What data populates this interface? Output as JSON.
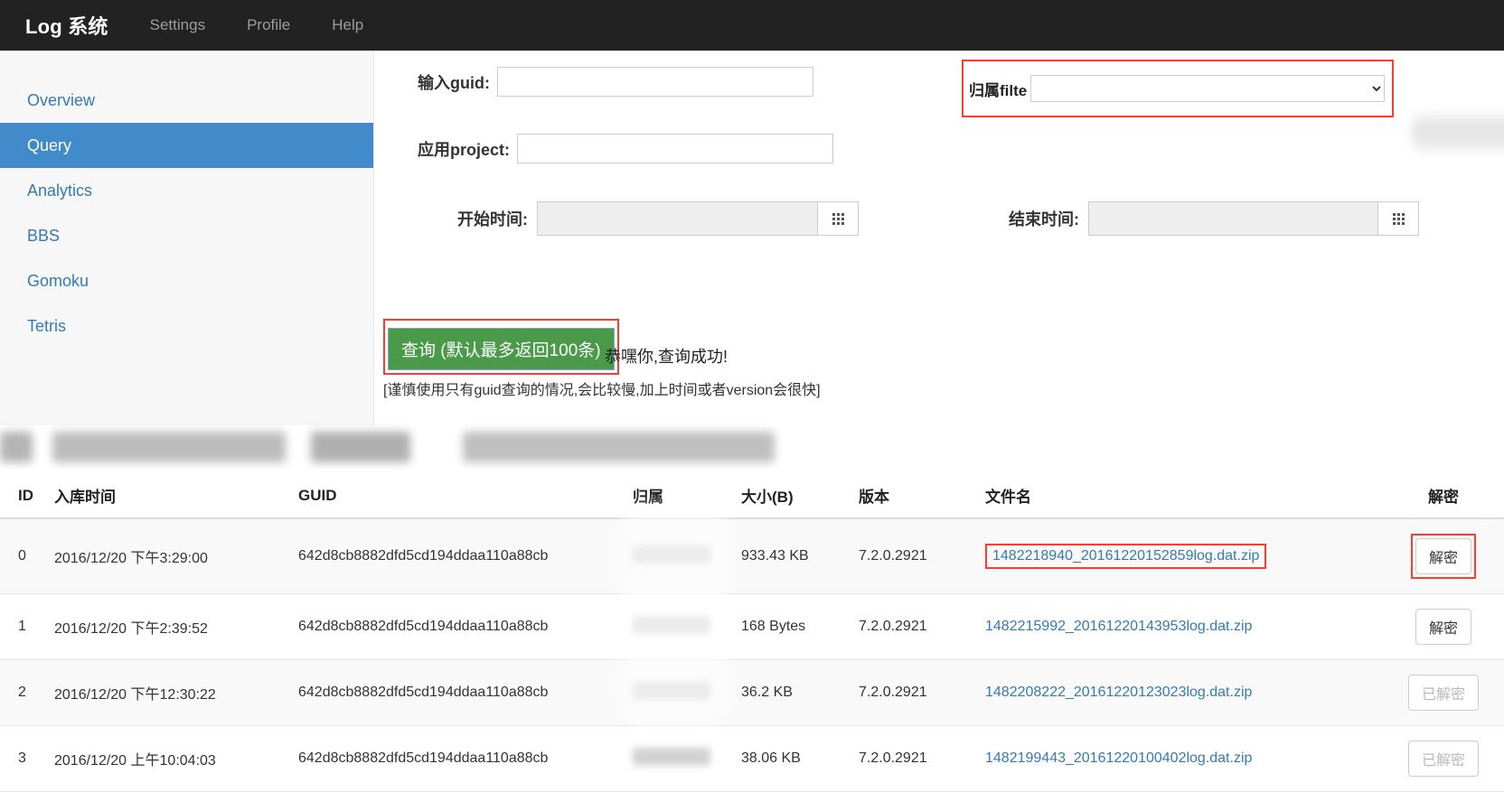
{
  "navbar": {
    "brand": "Log 系统",
    "links": [
      {
        "label": "Settings"
      },
      {
        "label": "Profile"
      },
      {
        "label": "Help"
      }
    ]
  },
  "sidebar": {
    "items": [
      {
        "label": "Overview",
        "active": false
      },
      {
        "label": "Query",
        "active": true
      },
      {
        "label": "Analytics",
        "active": false
      },
      {
        "label": "BBS",
        "active": false
      },
      {
        "label": "Gomoku",
        "active": false
      },
      {
        "label": "Tetris",
        "active": false
      }
    ]
  },
  "form": {
    "guid": {
      "label": "输入guid:",
      "value": "",
      "placeholder": ""
    },
    "project": {
      "label": "应用project:",
      "value": "",
      "placeholder": ""
    },
    "owner_filter": {
      "label": "归属filte",
      "value": "",
      "placeholder": ""
    },
    "start_time": {
      "label": "开始时间:",
      "value": "",
      "placeholder": ""
    },
    "end_time": {
      "label": "结束时间:",
      "value": "",
      "placeholder": ""
    },
    "calendar_icon": "calendar-icon"
  },
  "actions": {
    "query_button": "查询 (默认最多返回100条)",
    "success_message": "恭嘿你,查询成功!",
    "hint_message": "[谨慎使用只有guid查询的情况,会比较慢,加上时间或者version会很快]"
  },
  "table": {
    "headers": {
      "id": "ID",
      "time": "入库时间",
      "guid": "GUID",
      "owner": "归属",
      "size": "大小(B)",
      "version": "版本",
      "filename": "文件名",
      "decrypt": "解密"
    },
    "rows": [
      {
        "id": "0",
        "time": "2016/12/20 下午3:29:00",
        "guid": "642d8cb8882dfd5cd194ddaa110a88cb",
        "owner": "",
        "size": "933.43 KB",
        "version": "7.2.0.2921",
        "filename": "1482218940_20161220152859log.dat.zip",
        "decrypt_label": "解密",
        "decrypted": false,
        "highlight_file": true,
        "highlight_decrypt": true
      },
      {
        "id": "1",
        "time": "2016/12/20 下午2:39:52",
        "guid": "642d8cb8882dfd5cd194ddaa110a88cb",
        "owner": "",
        "size": "168 Bytes",
        "version": "7.2.0.2921",
        "filename": "1482215992_20161220143953log.dat.zip",
        "decrypt_label": "解密",
        "decrypted": false,
        "highlight_file": false,
        "highlight_decrypt": false
      },
      {
        "id": "2",
        "time": "2016/12/20 下午12:30:22",
        "guid": "642d8cb8882dfd5cd194ddaa110a88cb",
        "owner": "",
        "size": "36.2 KB",
        "version": "7.2.0.2921",
        "filename": "1482208222_20161220123023log.dat.zip",
        "decrypt_label": "已解密",
        "decrypted": true,
        "highlight_file": false,
        "highlight_decrypt": false
      },
      {
        "id": "3",
        "time": "2016/12/20 上午10:04:03",
        "guid": "642d8cb8882dfd5cd194ddaa110a88cb",
        "owner": "",
        "size": "38.06 KB",
        "version": "7.2.0.2921",
        "filename": "1482199443_20161220100402log.dat.zip",
        "decrypt_label": "已解密",
        "decrypted": true,
        "highlight_file": false,
        "highlight_decrypt": false
      }
    ]
  },
  "colors": {
    "navbar_bg": "#222222",
    "sidebar_bg": "#f7f7f7",
    "active_item": "#428bca",
    "link": "#337ab7",
    "query_button": "#4a9a4a",
    "highlight": "#ff3b30"
  }
}
